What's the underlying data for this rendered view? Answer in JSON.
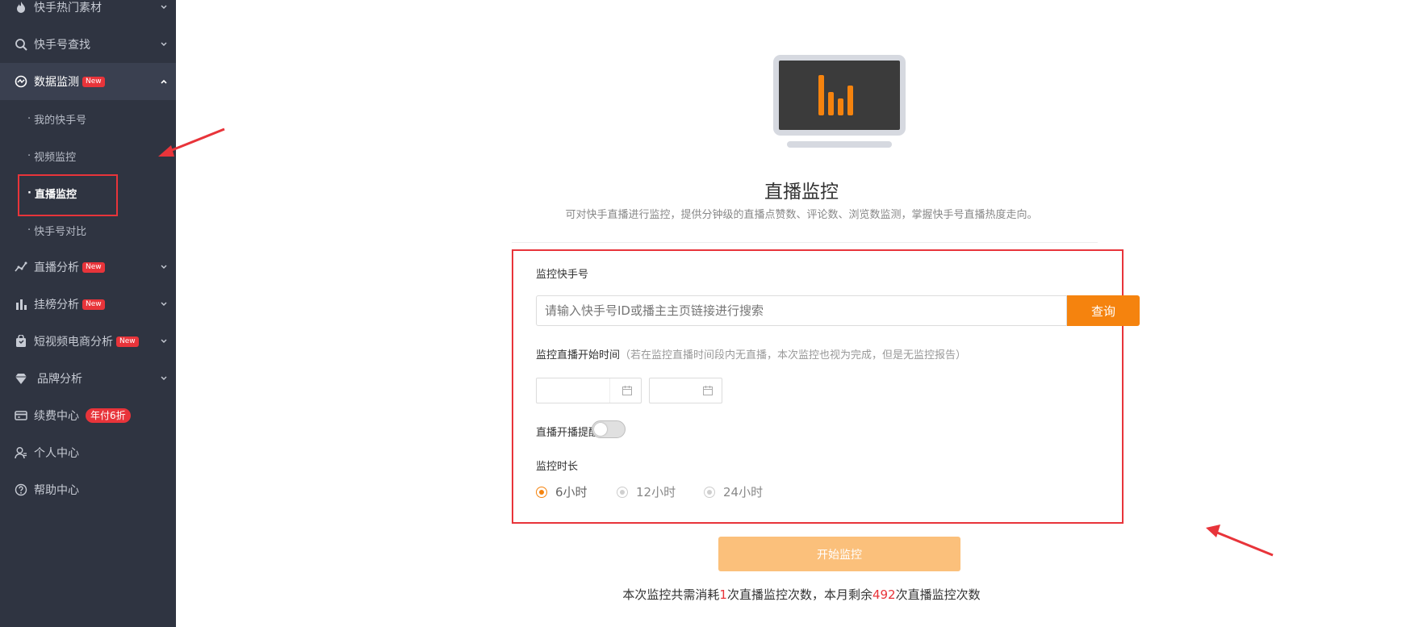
{
  "sidebar": {
    "items": [
      {
        "label": "快手热门素材",
        "icon": "fire-icon"
      },
      {
        "label": "快手号查找",
        "icon": "search-icon"
      },
      {
        "label": "数据监测",
        "icon": "monitor-chart-icon",
        "badge": "New"
      },
      {
        "label": "直播分析",
        "icon": "trend-icon",
        "badge": "New"
      },
      {
        "label": "挂榜分析",
        "icon": "bar-chart-icon",
        "badge": "New"
      },
      {
        "label": "短视频电商分析",
        "icon": "bag-icon",
        "badge": "New"
      },
      {
        "label": "品牌分析",
        "icon": "diamond-icon"
      },
      {
        "label": "续费中心",
        "icon": "card-icon",
        "badge": "年付6折"
      },
      {
        "label": "个人中心",
        "icon": "user-icon"
      },
      {
        "label": "帮助中心",
        "icon": "help-icon"
      }
    ],
    "sub_items": [
      {
        "label": "我的快手号"
      },
      {
        "label": "视频监控"
      },
      {
        "label": "直播监控"
      },
      {
        "label": "快手号对比"
      }
    ],
    "sub_dot": "·"
  },
  "main": {
    "title": "直播监控",
    "description": "可对快手直播进行监控，提供分钟级的直播点赞数、评论数、浏览数监测，掌握快手号直播热度走向。",
    "form": {
      "account_label": "监控快手号",
      "search_placeholder": "请输入快手号ID或播主主页链接进行搜索",
      "query_button": "查询",
      "start_time_label": "监控直播开始时间",
      "start_time_hint": "（若在监控直播时间段内无直播，本次监控也视为完成，但是无监控报告）",
      "reminder_label": "直播开播提醒:",
      "reminder_on": false,
      "duration_label": "监控时长",
      "duration_options": [
        "6小时",
        "12小时",
        "24小时"
      ],
      "duration_selected": "6小时"
    },
    "start_button": "开始监控",
    "note": {
      "part1": "本次监控共需消耗",
      "cost": "1",
      "part2": "次直播监控次数，本月剩余",
      "remaining": "492",
      "part3": "次直播监控次数"
    }
  },
  "colors": {
    "sidebar_bg": "#2f3441",
    "accent": "#f5830e",
    "highlight_red": "#e8343a"
  }
}
